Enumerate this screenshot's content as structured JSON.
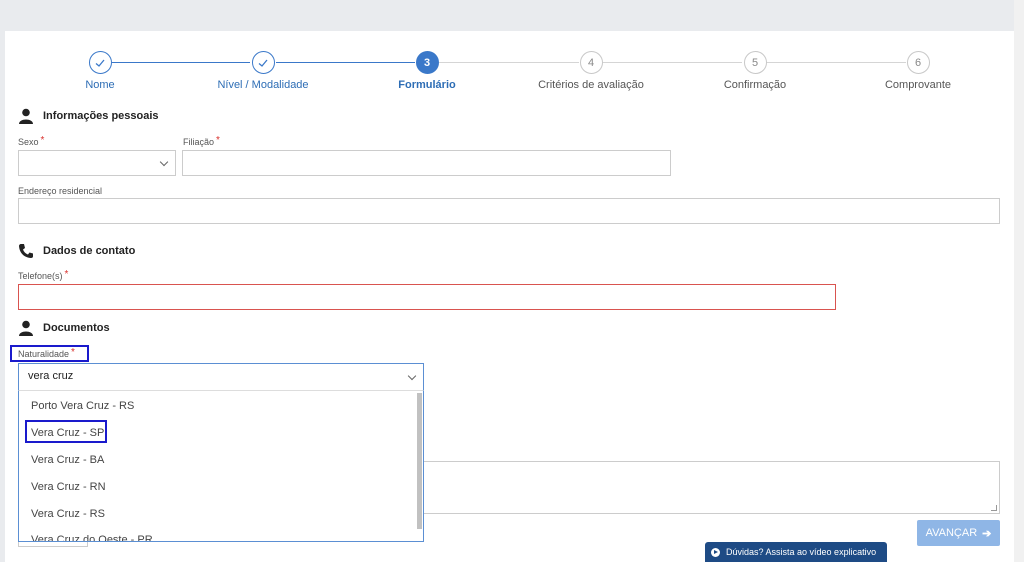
{
  "stepper": {
    "steps": [
      {
        "label": "Nome",
        "state": "done"
      },
      {
        "label": "Nível / Modalidade",
        "state": "done"
      },
      {
        "label": "Formulário",
        "number": "3",
        "state": "active"
      },
      {
        "label": "Critérios de avaliação",
        "number": "4",
        "state": "todo"
      },
      {
        "label": "Confirmação",
        "number": "5",
        "state": "todo"
      },
      {
        "label": "Comprovante",
        "number": "6",
        "state": "todo"
      }
    ]
  },
  "personal": {
    "title": "Informações pessoais",
    "sexo_label": "Sexo",
    "filiacao_label": "Filiação",
    "endereco_label": "Endereço residencial",
    "required_mark": "*"
  },
  "contact": {
    "title": "Dados de contato",
    "telefone_label": "Telefone(s)"
  },
  "documents": {
    "title": "Documentos",
    "naturalidade_label": "Naturalidade",
    "naturalidade_value": "vera cruz",
    "options": [
      "Porto Vera Cruz - RS",
      "Vera Cruz - SP",
      "Vera Cruz - BA",
      "Vera Cruz - RN",
      "Vera Cruz - RS",
      "Vera Cruz do Oeste - PR"
    ]
  },
  "actions": {
    "next_label": "AVANÇAR",
    "help_label": "Dúvidas? Assista ao vídeo explicativo"
  },
  "colors": {
    "accent": "#3a78c9",
    "error": "#d9534f",
    "highlight": "#1a1acc"
  }
}
